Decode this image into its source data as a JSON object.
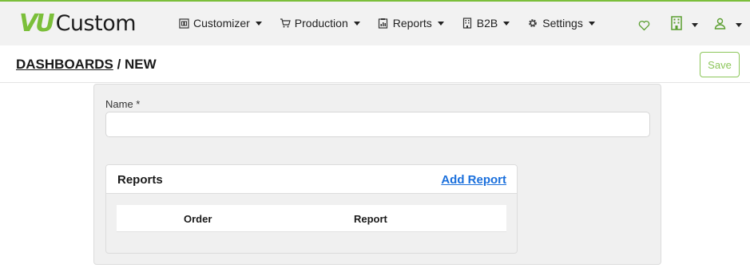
{
  "brand": {
    "logo_mark": "VU",
    "logo_text": "Custom",
    "accent": "#7bbf3a"
  },
  "nav": {
    "items": [
      {
        "label": "Customizer",
        "icon": "grid-box-icon"
      },
      {
        "label": "Production",
        "icon": "cart-icon"
      },
      {
        "label": "Reports",
        "icon": "clipboard-chart-icon"
      },
      {
        "label": "B2B",
        "icon": "building-icon"
      },
      {
        "label": "Settings",
        "icon": "gear-icon"
      }
    ],
    "right_icons": [
      "heart-icon",
      "building-icon",
      "user-icon"
    ]
  },
  "page": {
    "breadcrumb_parent": "DASHBOARDS",
    "breadcrumb_sep": " / ",
    "breadcrumb_current": "NEW",
    "save_label": "Save"
  },
  "form": {
    "name_label": "Name *",
    "name_value": ""
  },
  "reports": {
    "title": "Reports",
    "add_label": "Add Report",
    "columns": [
      "Order",
      "Report"
    ],
    "rows": []
  }
}
